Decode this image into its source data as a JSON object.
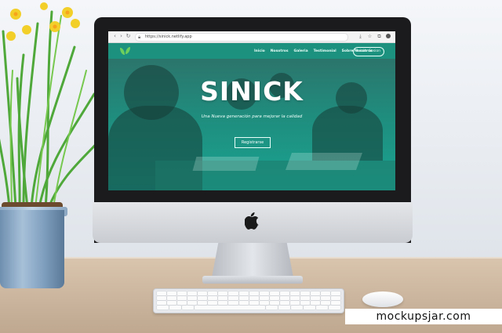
{
  "browser": {
    "url": "https://sinick.netlify.app",
    "back_icon": "arrow-left-icon",
    "forward_icon": "arrow-right-icon",
    "reload_icon": "reload-icon"
  },
  "site": {
    "nav": {
      "items": [
        "Inicio",
        "Nosotros",
        "Galeria",
        "Testimonial",
        "Sobre Nosotros"
      ],
      "login_label": "Iniciar Sesion"
    },
    "hero": {
      "title": "SINICK",
      "subtitle": "Una Nueva generación para mejorar la calidad",
      "cta_label": "Registrarse"
    },
    "colors": {
      "brand": "#1aa391",
      "nav": "#1a9682",
      "text": "#ffffff"
    }
  },
  "device": {
    "logo_icon": "apple-logo-icon"
  },
  "watermark": "mockupsjar.com"
}
